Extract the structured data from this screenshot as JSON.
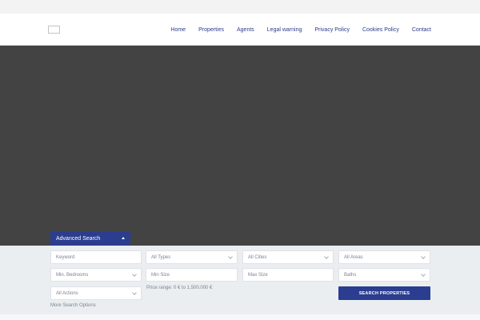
{
  "nav": {
    "items": [
      "Home",
      "Properties",
      "Agents",
      "Legal warning",
      "Privacy Policy",
      "Cookies Policy",
      "Contact"
    ]
  },
  "search": {
    "tab_label": "Advanced Search",
    "keyword": "Keyword",
    "types": "All Types",
    "cities": "All Cities",
    "areas": "All Areas",
    "bedrooms": "Min. Bedrooms",
    "min_size": "Min Size",
    "max_size": "Max Size",
    "baths": "Baths",
    "actions": "All Actions",
    "price_range": "Price range: 0 € to 1.500.000 €",
    "button": "SEARCH PROPERTIES",
    "more": "More Search Options"
  },
  "colors": {
    "accent": "#2b3d8f",
    "hero": "#434343",
    "panel": "#eaeef1"
  }
}
